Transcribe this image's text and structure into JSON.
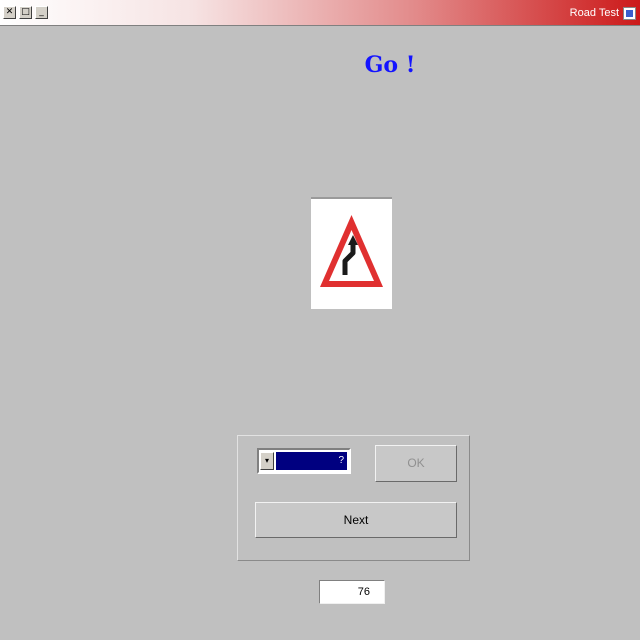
{
  "titlebar": {
    "title": "Road Test",
    "close_glyph": "✕",
    "max_glyph": "□",
    "min_glyph": "_",
    "icon": "app-icon"
  },
  "question": {
    "heading": "Go !"
  },
  "sign": {
    "icon": "double-bend-warning-sign",
    "colors": {
      "border": "#e03030",
      "arrow": "#1a1a1a",
      "fill": "#ffffff"
    }
  },
  "answer": {
    "dropdown_glyph": "▾",
    "selected_value": "?",
    "ok_label": "OK",
    "next_label": "Next"
  },
  "status": {
    "counter": "76"
  },
  "colors": {
    "window_bg": "#c0c0c0",
    "titlebar_start": "#ffffff",
    "titlebar_end": "#cc1a1a",
    "heading": "#1414ff",
    "selection": "#000080"
  }
}
